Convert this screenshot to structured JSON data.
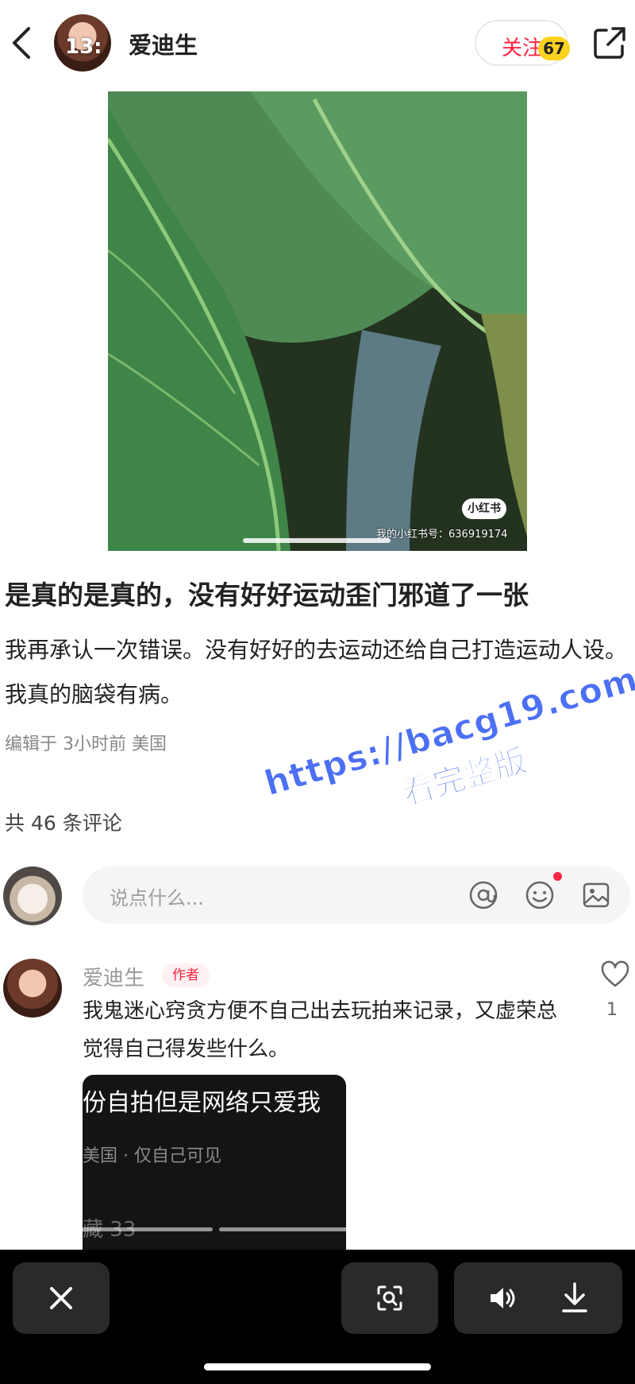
{
  "header": {
    "author_name": "爱迪生",
    "avatar_overlay_text": "13:",
    "follow_label": "关注",
    "follow_badge": "67",
    "icons": {
      "back": "chevron-left-icon",
      "share": "share-icon"
    }
  },
  "photo": {
    "watermark_logo": "小红书",
    "watermark_id": "我的小红书号：636919174"
  },
  "post": {
    "title": "是真的是真的，没有好好运动歪门邪道了一张",
    "body": "我再承认一次错误。没有好好的去运动还给自己打造运动人设。我真的脑袋有病。",
    "meta": "编辑于 3小时前 美国"
  },
  "comments": {
    "count_label": "共 46 条评论",
    "input_placeholder": "说点什么...",
    "input_icons": [
      "at-icon",
      "emoji-icon",
      "image-icon"
    ],
    "items": [
      {
        "name": "爱迪生",
        "tag": "作者",
        "text": "我鬼迷心窍贪方便不自己出去玩拍来记录，又虚荣总觉得自己得发些什么。",
        "likes": "1",
        "image_lines": [
          "份自拍但是网络只爱我",
          "美国 · 仅自己可见",
          "藏 33"
        ]
      }
    ]
  },
  "overlay_watermark": {
    "url": "https://bacg19.com",
    "subtitle": "看完整版"
  },
  "bottom_bar": {
    "icons": [
      "close-icon",
      "scan-icon",
      "volume-icon",
      "download-icon"
    ]
  },
  "colors": {
    "accent": "#ff2442",
    "badge": "#ffd21f",
    "watermark_blue": "#4b6ff5"
  }
}
